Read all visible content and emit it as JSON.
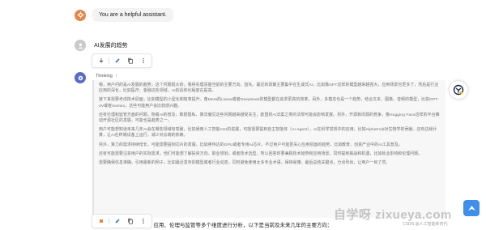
{
  "system": {
    "text": "You are a helpful assistant."
  },
  "user": {
    "text": "AI发展的趋势"
  },
  "assistant": {
    "thinking_label": "Thinking",
    "thinking_paragraphs": [
      "嗯，用户问的是AI发展的趋势，这个问题挺大的，我得先理清楚当前的主要方向。首先，最近的政策主要集中在生成式AI，比如像GPT这样的模型越来越强大，应用场景也更多了，然后是行业应用的深化，比如医疗、金融这些领域，AI的具体化程度在提高。",
      "接下来需要考虑技术层面，比如模型的小型化和效率提升，像Meta的Llama或者DeepSeek的模型都在追求更高的效率。另外，多模态也是一个趋势，结合文本、图像、音频的模型，比如GPT-4V或者Gemini，这些可能用户会比较感兴趣。",
      "还有伦理和监管方面的问题，随着AI的普及，数据隐私、算法偏见这些问题越来越受关注，欧盟的AI法案之类的法规可能会影响发展。另外，开源和闭源的竞争，像Hugging Face这样的平台推动开源社区的发展，可能也是趋势之一。",
      "用户可能想知道未来几年AI会在哪些领域有突破，比如通用人工智能AGI的进展，可能需要提到自主智能体（AI Agent），AI在科学发现中的应用，比如AlphaFold对生物学的贡献。还有边缘计算，让AI在终端设备上运行，减少对云端的依赖。",
      "另外，算力的需求持续增长，可能需要提到芯片的发展，比如英伟达的GPU或者专用AI芯片。不过用户可能更关心应用层面的趋势，比如教育、创意产业中的AI工具普及。",
      "还有可能需要注意用户的实际需求，他们可能想了解投资方向、职业规划，或者技术选型，所以回答时要兼顾技术趋势和应用场景，同时提到挑战和机遇，比如就业影响和伦理问题。",
      "需要确保信息准确，引用最新的例子，比如最近发布的模型或者行业动态，同时避免使用太多专业术语，保持易懂。最后总结关键点，分点列出，让用户一目了然。"
    ],
    "answer_visible": "技术、应用、伦理与监管等多个维度进行分析，以下是当前及未来几年的主要方向："
  },
  "toolbar_icons": [
    "download-icon",
    "edit-icon",
    "copy-icon",
    "more-icon"
  ],
  "bottom_toolbar_icons": [
    "stop-icon",
    "edit-icon",
    "copy-icon",
    "more-icon"
  ],
  "watermark": {
    "text": "自学呀 zixueya.com",
    "credit": "CSDN @人工智能新时代"
  },
  "colors": {
    "system_avatar": "#e4864a",
    "assistant_avatar": "#5a6cc8",
    "user_avatar": "#c9c9c9",
    "watermark_box": "#3f8ee8"
  }
}
